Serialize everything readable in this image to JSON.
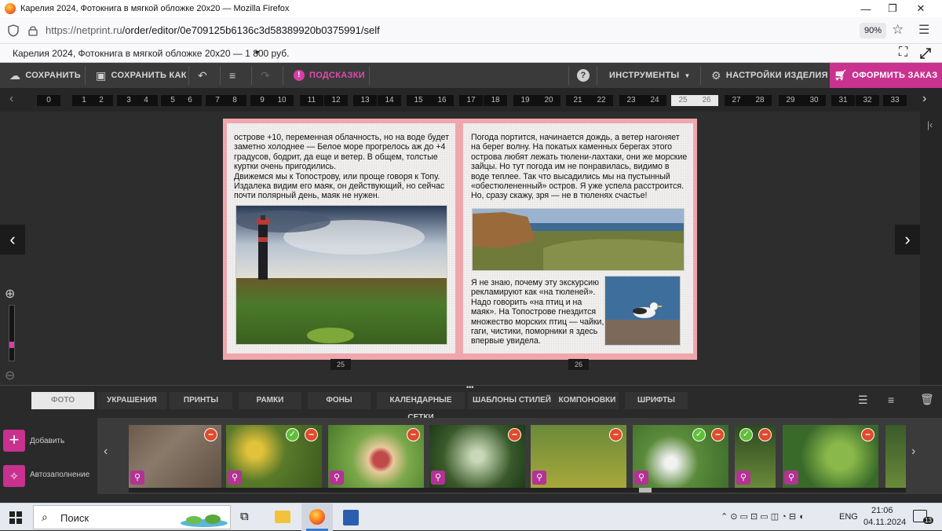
{
  "window": {
    "title": "Карелия 2024, Фотокнига в мягкой обложке 20x20 — Mozilla Firefox",
    "min": "—",
    "max": "❐",
    "close": "✕"
  },
  "browser": {
    "url_host": "https://netprint.ru",
    "url_path": "/order/editor/0e709125b6136c3d58389920b0375991/self",
    "zoom": "90%"
  },
  "product": {
    "title": "Карелия 2024, Фотокнига в мягкой обложке 20x20 — 1 800 руб."
  },
  "toolbar": {
    "save": "СОХРАНИТЬ",
    "save_as": "СОХРАНИТЬ КАК",
    "hints": "ПОДСКАЗКИ",
    "tools": "ИНСТРУМЕНТЫ",
    "product_settings": "НАСТРОЙКИ ИЗДЕЛИЯ",
    "checkout": "ОФОРМИТЬ ЗАКАЗ"
  },
  "pages": [
    "0",
    "1",
    "2",
    "3",
    "4",
    "5",
    "6",
    "7",
    "8",
    "9",
    "10",
    "11",
    "12",
    "13",
    "14",
    "15",
    "16",
    "17",
    "18",
    "19",
    "20",
    "21",
    "22",
    "23",
    "24",
    "25",
    "26",
    "27",
    "28",
    "29",
    "30",
    "31",
    "32",
    "33"
  ],
  "selected_pages": [
    "25",
    "26"
  ],
  "spread": {
    "left_text": "острове +10, переменная облачность, но на воде будет заметно холоднее — Белое море прогрелось аж до +4 градусов, бодрит, да еще и ветер. В общем, толстые куртки очень пригодились.\nДвижемся мы к Топострову, или проще говоря к Топу. Издалека видим его маяк, он действующий, но сейчас почти полярный день, маяк не нужен.",
    "right_text_top": "Погода портится, начинается дождь, а ветер нагоняет на берег волну. На покатых каменных берегах этого острова любят лежать тюлени-лахтаки, они же морские зайцы. Но тут погода им не понравилась, видимо в воде теплее. Так что высадились мы на пустынный «обестюлененный» остров. Я уже успела расстроится. Но, сразу скажу, зря — не в тюленях счастье!",
    "right_text_bottom": "Я не знаю, почему эту экскурсию рекламируют как «на тюленей». Надо говорить «на птиц и на маяк». На Топострове гнездится множество морских птиц — чайки, гаги, чистики, поморники я здесь впервые увидела.",
    "left_page_number": "25",
    "right_page_number": "26"
  },
  "tabs": [
    "ФОТО",
    "УКРАШЕНИЯ",
    "ПРИНТЫ",
    "РАМКИ",
    "ФОНЫ",
    "КАЛЕНДАРНЫЕ СЕТКИ",
    "ШАБЛОНЫ СТИЛЕЙ",
    "КОМПОНОВКИ",
    "ШРИФТЫ"
  ],
  "side_actions": {
    "add": "Добавить",
    "autofill": "Автозаполнение"
  },
  "thumbnails": [
    {
      "name": "rocks-flowers",
      "used": false
    },
    {
      "name": "yellow-flowers",
      "used": true
    },
    {
      "name": "child",
      "used": false
    },
    {
      "name": "umbellifer",
      "used": false
    },
    {
      "name": "child-meadow",
      "used": false
    },
    {
      "name": "white-flowers",
      "used": true
    },
    {
      "name": "plant-closeup",
      "used": true
    },
    {
      "name": "green-leaves",
      "used": false
    },
    {
      "name": "partial",
      "used": false
    }
  ],
  "taskbar": {
    "search": "Поиск",
    "lang": "ENG",
    "time": "21:06",
    "date": "04.11.2024",
    "notifications": "13"
  }
}
